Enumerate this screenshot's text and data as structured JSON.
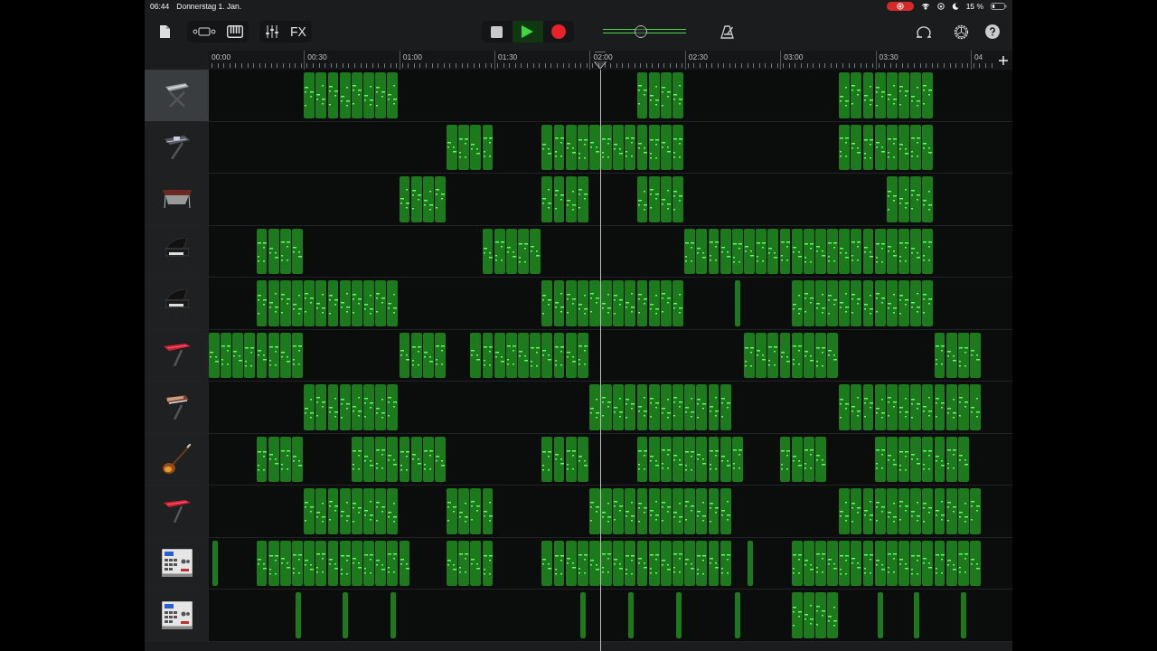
{
  "status_bar": {
    "time": "06:44",
    "date": "Donnerstag 1. Jan.",
    "recording": true,
    "battery": "15 %"
  },
  "toolbar": {
    "fx": "FX",
    "playing": true,
    "recording": false,
    "volume": {
      "level": 0.46
    }
  },
  "ruler": {
    "labels": [
      "00:00",
      "00:30",
      "01:00",
      "01:30",
      "02:00",
      "02:30",
      "03:00",
      "03:30",
      "04"
    ],
    "playhead": {
      "level": 0.487
    }
  },
  "tracks": [
    {
      "kind": "keyboard",
      "selected": true,
      "beats": [
        false,
        false,
        false,
        false,
        false,
        false,
        false,
        false,
        true,
        true,
        true,
        true,
        true,
        true,
        true,
        true,
        false,
        false,
        false,
        false,
        false,
        false,
        false,
        false,
        false,
        false,
        false,
        false,
        false,
        false,
        false,
        false,
        false,
        false,
        false,
        false,
        true,
        true,
        true,
        true,
        false,
        false,
        false,
        false,
        false,
        false,
        false,
        false,
        false,
        false,
        false,
        false,
        false,
        true,
        true,
        true,
        true,
        true,
        true,
        true,
        true,
        false,
        false,
        false,
        false,
        false,
        false
      ]
    },
    {
      "kind": "workstation",
      "selected": false,
      "beats": [
        false,
        false,
        false,
        false,
        false,
        false,
        false,
        false,
        false,
        false,
        false,
        false,
        false,
        false,
        false,
        false,
        false,
        false,
        false,
        false,
        true,
        true,
        true,
        true,
        false,
        false,
        false,
        false,
        true,
        true,
        true,
        true,
        true,
        true,
        true,
        true,
        true,
        true,
        true,
        true,
        false,
        false,
        false,
        false,
        false,
        false,
        false,
        false,
        false,
        false,
        false,
        false,
        false,
        true,
        true,
        true,
        true,
        true,
        true,
        true,
        true,
        false,
        false,
        false,
        false,
        false,
        false
      ]
    },
    {
      "kind": "vibraphone",
      "selected": false,
      "beats": [
        false,
        false,
        false,
        false,
        false,
        false,
        false,
        false,
        false,
        false,
        false,
        false,
        false,
        false,
        false,
        false,
        true,
        true,
        true,
        true,
        false,
        false,
        false,
        false,
        false,
        false,
        false,
        false,
        true,
        true,
        true,
        true,
        false,
        false,
        false,
        false,
        true,
        true,
        true,
        true,
        false,
        false,
        false,
        false,
        false,
        false,
        false,
        false,
        false,
        false,
        false,
        false,
        false,
        false,
        false,
        false,
        false,
        true,
        true,
        true,
        true,
        false,
        false,
        false,
        false,
        false,
        false
      ]
    },
    {
      "kind": "piano",
      "selected": false,
      "beats": [
        false,
        false,
        false,
        false,
        true,
        true,
        true,
        true,
        false,
        false,
        false,
        false,
        false,
        false,
        false,
        false,
        false,
        false,
        false,
        false,
        false,
        false,
        false,
        true,
        true,
        true,
        true,
        true,
        false,
        false,
        false,
        false,
        false,
        false,
        false,
        false,
        false,
        false,
        false,
        false,
        true,
        true,
        true,
        true,
        true,
        true,
        true,
        true,
        true,
        true,
        true,
        true,
        true,
        true,
        true,
        true,
        true,
        true,
        true,
        true,
        true,
        false,
        false,
        false,
        false,
        false,
        false
      ]
    },
    {
      "kind": "piano",
      "selected": false,
      "beats": [
        false,
        false,
        false,
        false,
        true,
        true,
        true,
        true,
        true,
        true,
        true,
        true,
        true,
        true,
        true,
        true,
        false,
        false,
        false,
        false,
        false,
        false,
        false,
        false,
        false,
        false,
        false,
        false,
        true,
        true,
        true,
        true,
        true,
        true,
        true,
        true,
        true,
        true,
        true,
        true,
        false,
        false,
        false,
        false,
        true,
        false,
        false,
        false,
        false,
        true,
        true,
        true,
        true,
        true,
        true,
        true,
        true,
        true,
        true,
        true,
        true,
        false,
        false,
        false,
        false,
        false,
        false
      ]
    },
    {
      "kind": "stage-piano",
      "selected": false,
      "beats": [
        true,
        true,
        true,
        true,
        true,
        true,
        true,
        true,
        false,
        false,
        false,
        false,
        false,
        false,
        false,
        false,
        true,
        true,
        true,
        true,
        false,
        false,
        true,
        true,
        true,
        true,
        true,
        true,
        true,
        true,
        true,
        true,
        false,
        false,
        false,
        false,
        false,
        false,
        false,
        false,
        false,
        false,
        false,
        false,
        false,
        true,
        true,
        true,
        true,
        true,
        true,
        true,
        true,
        false,
        false,
        false,
        false,
        false,
        false,
        false,
        false,
        true,
        true,
        true,
        true,
        false,
        false
      ]
    },
    {
      "kind": "synth",
      "selected": false,
      "beats": [
        false,
        false,
        false,
        false,
        false,
        false,
        false,
        false,
        true,
        true,
        true,
        true,
        true,
        true,
        true,
        true,
        false,
        false,
        false,
        false,
        false,
        false,
        false,
        false,
        false,
        false,
        false,
        false,
        false,
        false,
        false,
        false,
        true,
        true,
        true,
        true,
        true,
        true,
        true,
        true,
        true,
        true,
        true,
        true,
        false,
        false,
        false,
        false,
        false,
        false,
        false,
        false,
        false,
        true,
        true,
        true,
        true,
        true,
        true,
        true,
        true,
        true,
        true,
        true,
        true,
        false,
        false
      ]
    },
    {
      "kind": "bass",
      "selected": false,
      "beats": [
        false,
        false,
        false,
        false,
        true,
        true,
        true,
        true,
        false,
        false,
        false,
        false,
        true,
        true,
        true,
        true,
        true,
        true,
        true,
        true,
        false,
        false,
        false,
        false,
        false,
        false,
        false,
        false,
        true,
        true,
        true,
        true,
        false,
        false,
        false,
        false,
        true,
        true,
        true,
        true,
        true,
        true,
        true,
        true,
        true,
        false,
        false,
        false,
        true,
        true,
        true,
        true,
        false,
        false,
        false,
        false,
        true,
        true,
        true,
        true,
        true,
        true,
        true,
        true,
        false,
        false,
        false
      ]
    },
    {
      "kind": "stage-piano",
      "selected": false,
      "beats": [
        false,
        false,
        false,
        false,
        false,
        false,
        false,
        false,
        true,
        true,
        true,
        true,
        true,
        true,
        true,
        true,
        false,
        false,
        false,
        false,
        true,
        true,
        true,
        true,
        false,
        false,
        false,
        false,
        false,
        false,
        false,
        false,
        true,
        true,
        true,
        true,
        true,
        true,
        true,
        true,
        true,
        true,
        true,
        true,
        false,
        false,
        false,
        false,
        false,
        false,
        false,
        false,
        false,
        true,
        true,
        true,
        true,
        true,
        true,
        true,
        true,
        true,
        true,
        true,
        true,
        false,
        false
      ]
    },
    {
      "kind": "drum-machine",
      "selected": false,
      "beats": [
        true,
        false,
        false,
        false,
        true,
        true,
        true,
        true,
        true,
        true,
        true,
        true,
        true,
        true,
        true,
        true,
        true,
        false,
        false,
        false,
        true,
        true,
        true,
        true,
        false,
        false,
        false,
        false,
        true,
        true,
        true,
        true,
        true,
        true,
        true,
        true,
        true,
        true,
        true,
        true,
        true,
        true,
        true,
        true,
        false,
        true,
        false,
        false,
        false,
        true,
        true,
        true,
        true,
        true,
        true,
        true,
        true,
        true,
        true,
        true,
        true,
        true,
        true,
        true,
        true,
        false,
        false
      ]
    },
    {
      "kind": "drum-machine",
      "selected": false,
      "beats": [
        false,
        false,
        false,
        false,
        false,
        false,
        false,
        true,
        false,
        false,
        false,
        true,
        false,
        false,
        false,
        true,
        false,
        false,
        false,
        false,
        false,
        false,
        false,
        false,
        false,
        false,
        false,
        false,
        false,
        false,
        false,
        true,
        false,
        false,
        false,
        true,
        false,
        false,
        false,
        true,
        false,
        false,
        false,
        false,
        true,
        false,
        false,
        false,
        false,
        true,
        true,
        true,
        true,
        false,
        false,
        false,
        true,
        false,
        false,
        true,
        false,
        false,
        false,
        true,
        false,
        false,
        false
      ]
    }
  ]
}
